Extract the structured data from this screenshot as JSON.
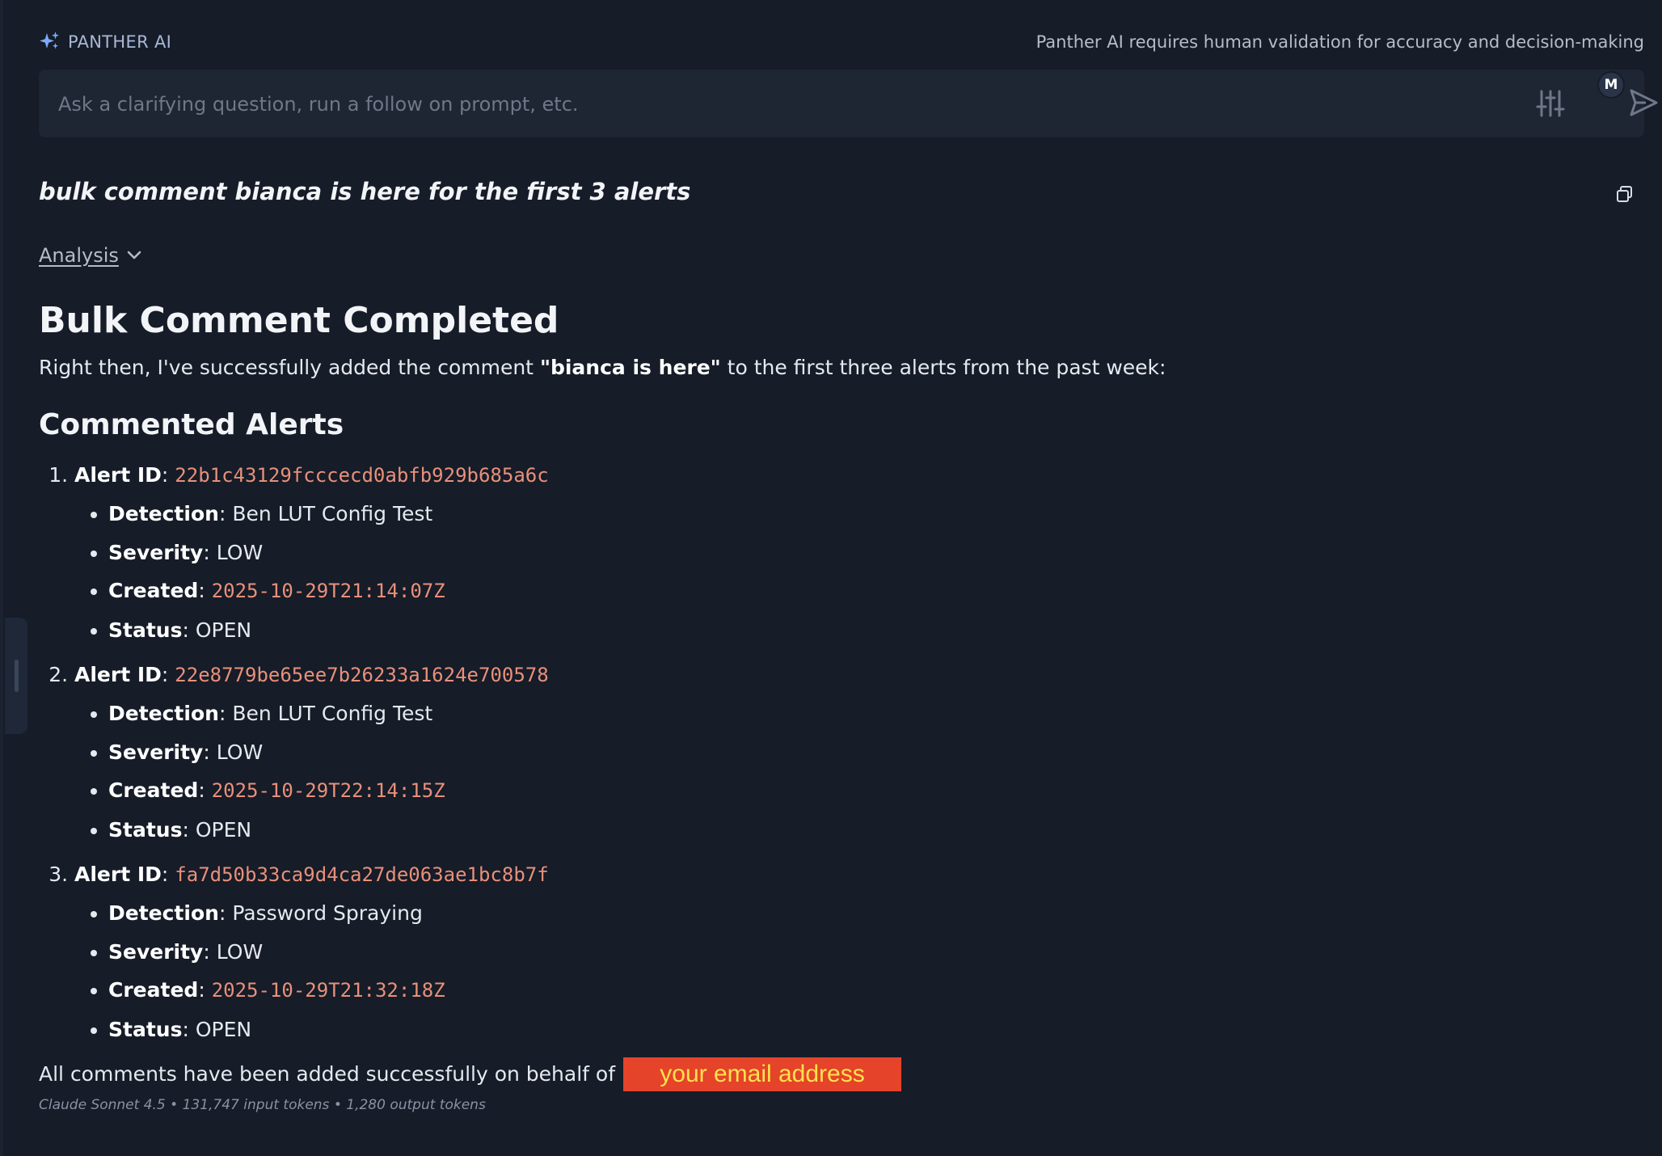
{
  "header": {
    "brand": "PANTHER AI",
    "disclaimer": "Panther AI requires human validation for accuracy and decision-making"
  },
  "prompt": {
    "placeholder": "Ask a clarifying question, run a follow on prompt, etc.",
    "avatar_initial": "M"
  },
  "conversation": {
    "user_prompt": "bulk comment bianca is here for the first 3 alerts",
    "analysis_label": "Analysis"
  },
  "response": {
    "title": "Bulk Comment Completed",
    "intro_before": "Right then, I've successfully added the comment ",
    "intro_bold": "\"bianca is here\"",
    "intro_after": " to the first three alerts from the past week:",
    "section_title": "Commented Alerts",
    "labels": {
      "alert_id": "Alert ID",
      "detection": "Detection",
      "severity": "Severity",
      "created": "Created",
      "status": "Status"
    },
    "alerts": [
      {
        "alert_id": "22b1c43129fcccecd0abfb929b685a6c",
        "detection": "Ben LUT Config Test",
        "severity": "LOW",
        "created": "2025-10-29T21:14:07Z",
        "status": "OPEN"
      },
      {
        "alert_id": "22e8779be65ee7b26233a1624e700578",
        "detection": "Ben LUT Config Test",
        "severity": "LOW",
        "created": "2025-10-29T22:14:15Z",
        "status": "OPEN"
      },
      {
        "alert_id": "fa7d50b33ca9d4ca27de063ae1bc8b7f",
        "detection": "Password Spraying",
        "severity": "LOW",
        "created": "2025-10-29T21:32:18Z",
        "status": "OPEN"
      }
    ],
    "footer_text": "All comments have been added successfully on behalf of",
    "redacted_email": "your email address",
    "meta": "Claude Sonnet 4.5 • 131,747 input tokens • 1,280 output tokens"
  },
  "colors": {
    "background": "#161c28",
    "code_accent": "#e8907a",
    "redaction_fill": "#e5432a",
    "redaction_text": "#ffe14d",
    "brand_icon": "#7fa8ff"
  }
}
